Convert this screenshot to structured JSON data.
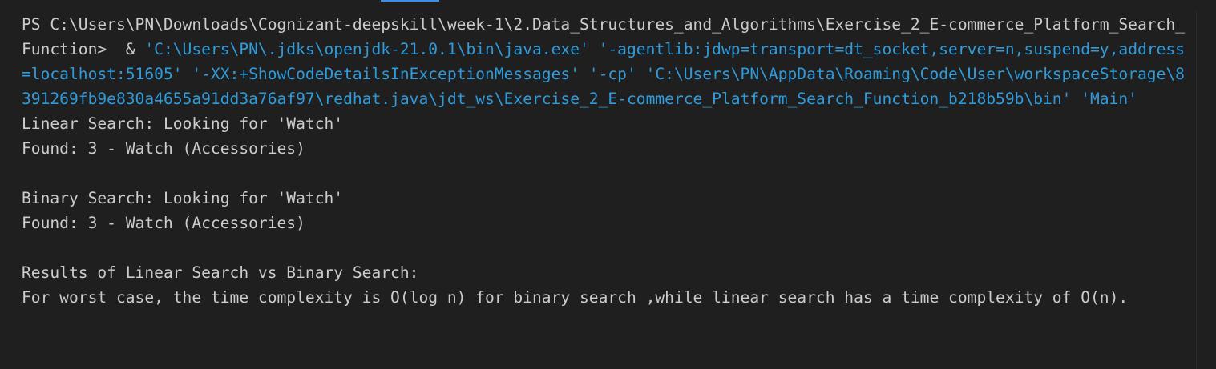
{
  "terminal": {
    "prompt": "PS C:\\Users\\PN\\Downloads\\Cognizant-deepskill\\week-1\\2.Data_Structures_and_Algorithms\\Exercise_2_E-commerce_Platform_Search_Function>  & ",
    "command": "'C:\\Users\\PN\\.jdks\\openjdk-21.0.1\\bin\\java.exe' '-agentlib:jdwp=transport=dt_socket,server=n,suspend=y,address=localhost:51605' '-XX:+ShowCodeDetailsInExceptionMessages' '-cp' 'C:\\Users\\PN\\AppData\\Roaming\\Code\\User\\workspaceStorage\\8391269fb9e830a4655a91dd3a76af97\\redhat.java\\jdt_ws\\Exercise_2_E-commerce_Platform_Search_Function_b218b59b\\bin' 'Main'",
    "output_lines": [
      "Linear Search: Looking for 'Watch'",
      "Found: 3 - Watch (Accessories)",
      "",
      "Binary Search: Looking for 'Watch'",
      "Found: 3 - Watch (Accessories)",
      "",
      "Results of Linear Search vs Binary Search:",
      "For worst case, the time complexity is O(log n) for binary search ,while linear search has a time complexity of O(n)."
    ]
  },
  "colors": {
    "background": "#1f1f1f",
    "foreground": "#cccccc",
    "command": "#2f9bdb"
  }
}
